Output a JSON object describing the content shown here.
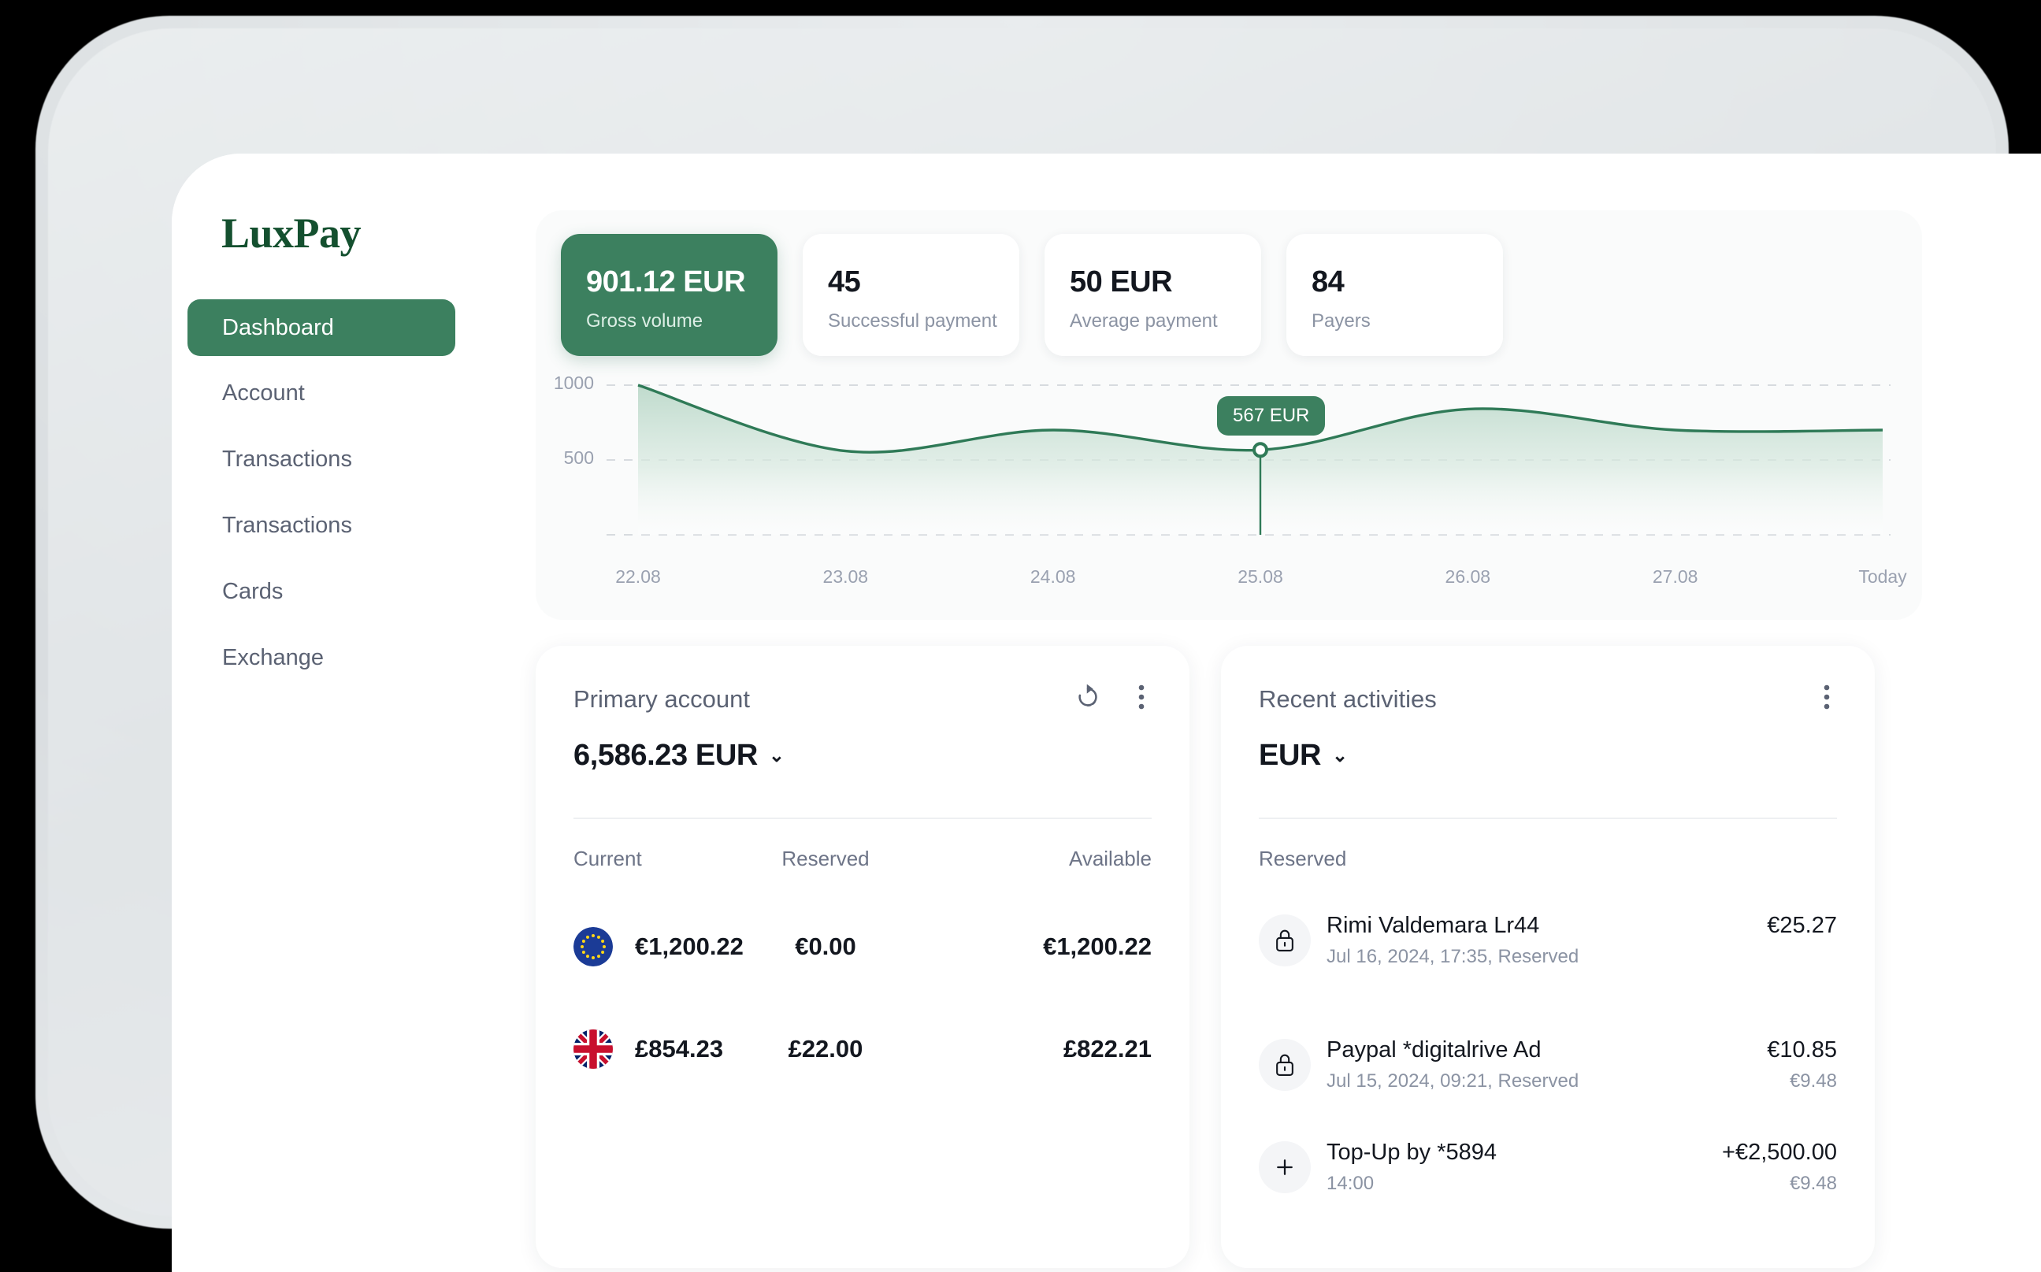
{
  "brand": {
    "name": "LuxPay"
  },
  "sidebar": {
    "items": [
      {
        "label": "Dashboard",
        "active": true
      },
      {
        "label": "Account",
        "active": false
      },
      {
        "label": "Transactions",
        "active": false
      },
      {
        "label": "Transactions",
        "active": false
      },
      {
        "label": "Cards",
        "active": false
      },
      {
        "label": "Exchange",
        "active": false
      }
    ]
  },
  "stats": [
    {
      "value": "901.12 EUR",
      "label": "Gross volume",
      "primary": true
    },
    {
      "value": "45",
      "label": "Successful payment",
      "primary": false
    },
    {
      "value": "50 EUR",
      "label": "Average payment",
      "primary": false
    },
    {
      "value": "84",
      "label": "Payers",
      "primary": false
    }
  ],
  "chart_data": {
    "type": "area",
    "title": "",
    "xlabel": "",
    "ylabel": "",
    "categories": [
      "22.08",
      "23.08",
      "24.08",
      "25.08",
      "26.08",
      "27.08",
      "Today"
    ],
    "values": [
      1000,
      560,
      700,
      567,
      840,
      700,
      700
    ],
    "ylim": [
      0,
      1000
    ],
    "y_ticks": [
      "1000",
      "500"
    ],
    "y_tick_values": [
      1000,
      500
    ],
    "grid": true,
    "legend": "none",
    "line_color": "#2f7a57",
    "fill_color": "#cfe3d8",
    "tooltip": {
      "label": "567 EUR",
      "value": 567,
      "category": "25.08"
    }
  },
  "primary_account": {
    "title": "Primary account",
    "amount": "6,586.23 EUR",
    "chevron": "⌄",
    "columns": [
      "Current",
      "Reserved",
      "Available"
    ],
    "rows": [
      {
        "flag": "eu-flag-icon",
        "current": "€1,200.22",
        "reserved": "€0.00",
        "available": "€1,200.22"
      },
      {
        "flag": "gb-flag-icon",
        "current": "£854.23",
        "reserved": "£22.00",
        "available": "£822.21"
      }
    ]
  },
  "recent_activities": {
    "title": "Recent activities",
    "currency": "EUR",
    "chevron": "⌄",
    "section_label": "Reserved",
    "items": [
      {
        "icon": "lock-icon",
        "title": "Rimi Valdemara Lr44",
        "subtitle": "Jul 16, 2024, 17:35, Reserved",
        "amount": "€25.27",
        "secondary_amount": ""
      },
      {
        "icon": "lock-icon",
        "title": "Paypal *digitalrive Ad",
        "subtitle": "Jul 15, 2024, 09:21, Reserved",
        "amount": "€10.85",
        "secondary_amount": "€9.48"
      },
      {
        "icon": "plus-icon",
        "title": "Top-Up by *5894",
        "subtitle": "14:00",
        "amount": "+€2,500.00",
        "secondary_amount": "€9.48"
      }
    ]
  },
  "colors": {
    "brand_green": "#14502f",
    "accent_green": "#3c805f",
    "chart_line": "#2f7a57",
    "text_dark": "#13171f",
    "text_muted": "#8b93a3"
  }
}
